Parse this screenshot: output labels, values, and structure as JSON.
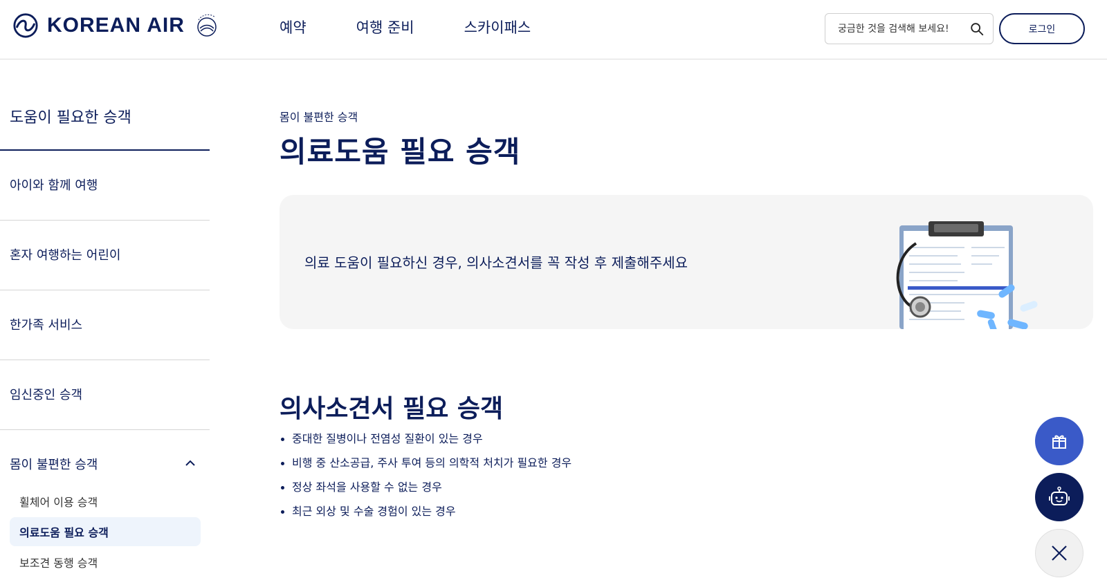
{
  "header": {
    "logo_text": "KOREAN AIR",
    "nav": [
      {
        "label": "예약"
      },
      {
        "label": "여행 준비"
      },
      {
        "label": "스카이패스"
      }
    ],
    "search_placeholder": "궁금한 것을 검색해 보세요!",
    "login_label": "로그인"
  },
  "sidebar": {
    "title": "도움이 필요한 승객",
    "items": [
      {
        "label": "아이와 함께 여행"
      },
      {
        "label": "혼자 여행하는 어린이"
      },
      {
        "label": "한가족 서비스"
      },
      {
        "label": "임신중인 승객"
      },
      {
        "label": "몸이 불편한 승객",
        "expanded": true
      }
    ],
    "sub_items": [
      {
        "label": "휠체어 이용 승객"
      },
      {
        "label": "의료도움 필요 승객",
        "active": true
      },
      {
        "label": "보조견 동행 승객"
      }
    ]
  },
  "main": {
    "breadcrumb": "몸이 불편한 승객",
    "title": "의료도움 필요 승객",
    "banner_text": "의료 도움이 필요하신 경우, 의사소견서를 꼭 작성 후 제출해주세요",
    "section_title": "의사소견서 필요 승객",
    "bullets": [
      "중대한 질병이나 전염성 질환이 있는 경우",
      "비행 중 산소공급, 주사 투여 등의 의학적 처치가 필요한 경우",
      "정상 좌석을 사용할 수 없는 경우",
      "최근 외상 및 수술 경험이 있는 경우"
    ]
  },
  "colors": {
    "brand_navy": "#0c1d5a",
    "fab_blue": "#3a5ac8",
    "active_bg": "#eef4fc",
    "banner_bg": "#f5f5f5"
  },
  "icons": {
    "search": "search-icon",
    "chevron": "chevron-up-icon",
    "gift": "gift-icon",
    "chatbot": "chatbot-icon",
    "close": "close-icon"
  }
}
